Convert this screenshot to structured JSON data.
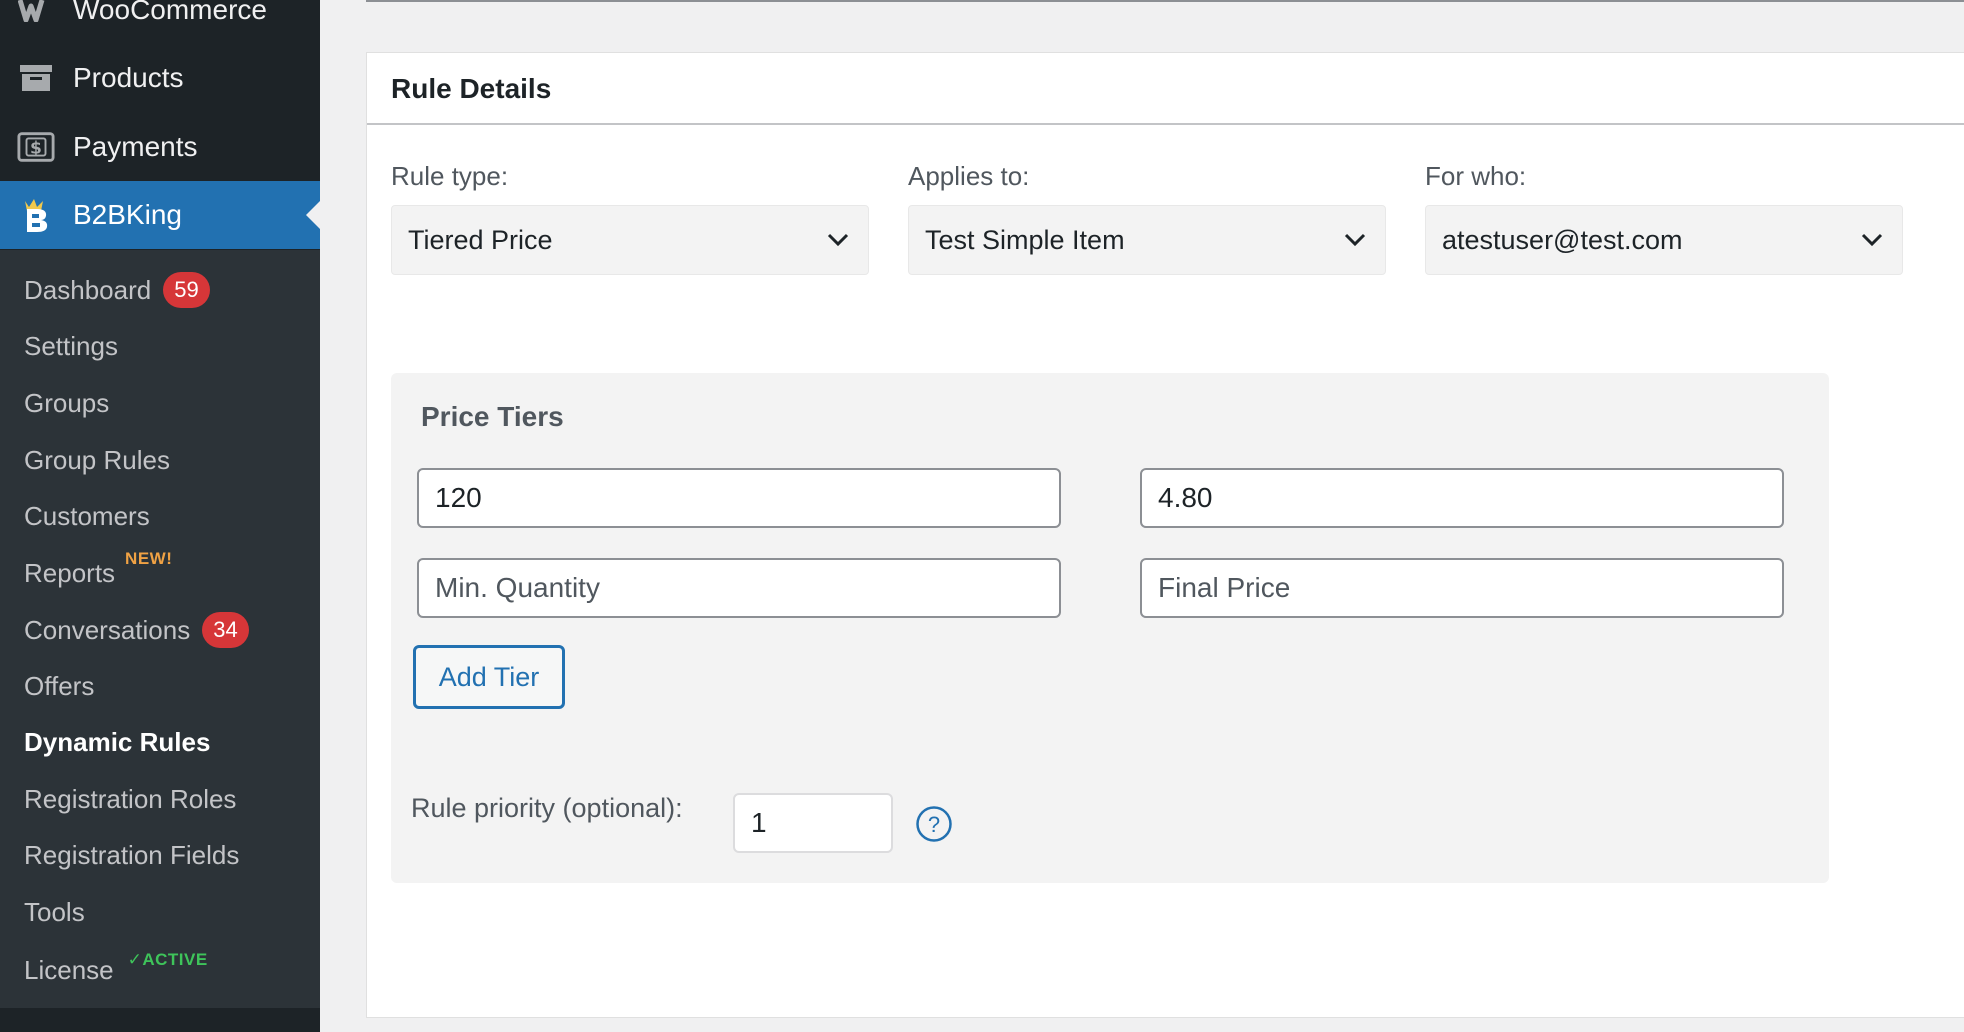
{
  "sidebar": {
    "top_items": [
      {
        "label": "WooCommerce",
        "icon": "woocommerce-icon"
      },
      {
        "label": "Products",
        "icon": "archive-box-icon"
      },
      {
        "label": "Payments",
        "icon": "dollar-card-icon"
      },
      {
        "label": "B2BKing",
        "icon": "b2bking-logo-icon",
        "current": true
      }
    ],
    "submenu": [
      {
        "label": "Dashboard",
        "badge": "59"
      },
      {
        "label": "Settings"
      },
      {
        "label": "Groups"
      },
      {
        "label": "Group Rules"
      },
      {
        "label": "Customers"
      },
      {
        "label": "Reports",
        "tag": "NEW!"
      },
      {
        "label": "Conversations",
        "badge": "34"
      },
      {
        "label": "Offers"
      },
      {
        "label": "Dynamic Rules",
        "current": true
      },
      {
        "label": "Registration Roles"
      },
      {
        "label": "Registration Fields"
      },
      {
        "label": "Tools"
      },
      {
        "label": "License",
        "tag": "✓ACTIVE"
      }
    ]
  },
  "rule_details": {
    "title": "Rule Details",
    "rule_type": {
      "label": "Rule type:",
      "value": "Tiered Price"
    },
    "applies_to": {
      "label": "Applies to:",
      "value": "Test Simple Item"
    },
    "for_who": {
      "label": "For who:",
      "value": "atestuser@test.com"
    }
  },
  "price_tiers": {
    "title": "Price Tiers",
    "rows": [
      {
        "quantity": "120",
        "price": "4.80"
      },
      {
        "quantity": "",
        "price": ""
      }
    ],
    "quantity_placeholder": "Min. Quantity",
    "price_placeholder": "Final Price",
    "add_tier_label": "Add Tier"
  },
  "priority": {
    "label": "Rule priority (optional):",
    "value": "1",
    "help_glyph": "?"
  },
  "colors": {
    "sidebar_bg": "#1d2327",
    "submenu_bg": "#2c3338",
    "accent": "#2271b1",
    "badge": "#d63638",
    "new_tag": "#f0a244",
    "active_tag": "#3ec45a"
  }
}
